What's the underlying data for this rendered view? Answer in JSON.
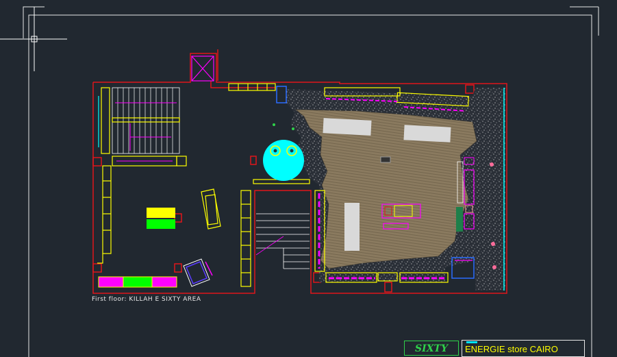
{
  "drawing": {
    "caption": "First floor: KILLAH E SIXTY AREA",
    "logo_text": "SIXTY",
    "title_text": "ENERGIE store CAIRO"
  },
  "colors": {
    "background": "#212830",
    "wall": "#e0161b",
    "accent_yellow": "#ffff00",
    "accent_magenta": "#ff00ff",
    "accent_cyan": "#00ffff",
    "accent_green": "#00ff00",
    "floor_wood": "#8a7a5f",
    "frame": "#e8e8e8"
  },
  "icons": [
    "crosshair-cursor-icon",
    "staircase-symbol",
    "round-table-symbol"
  ]
}
